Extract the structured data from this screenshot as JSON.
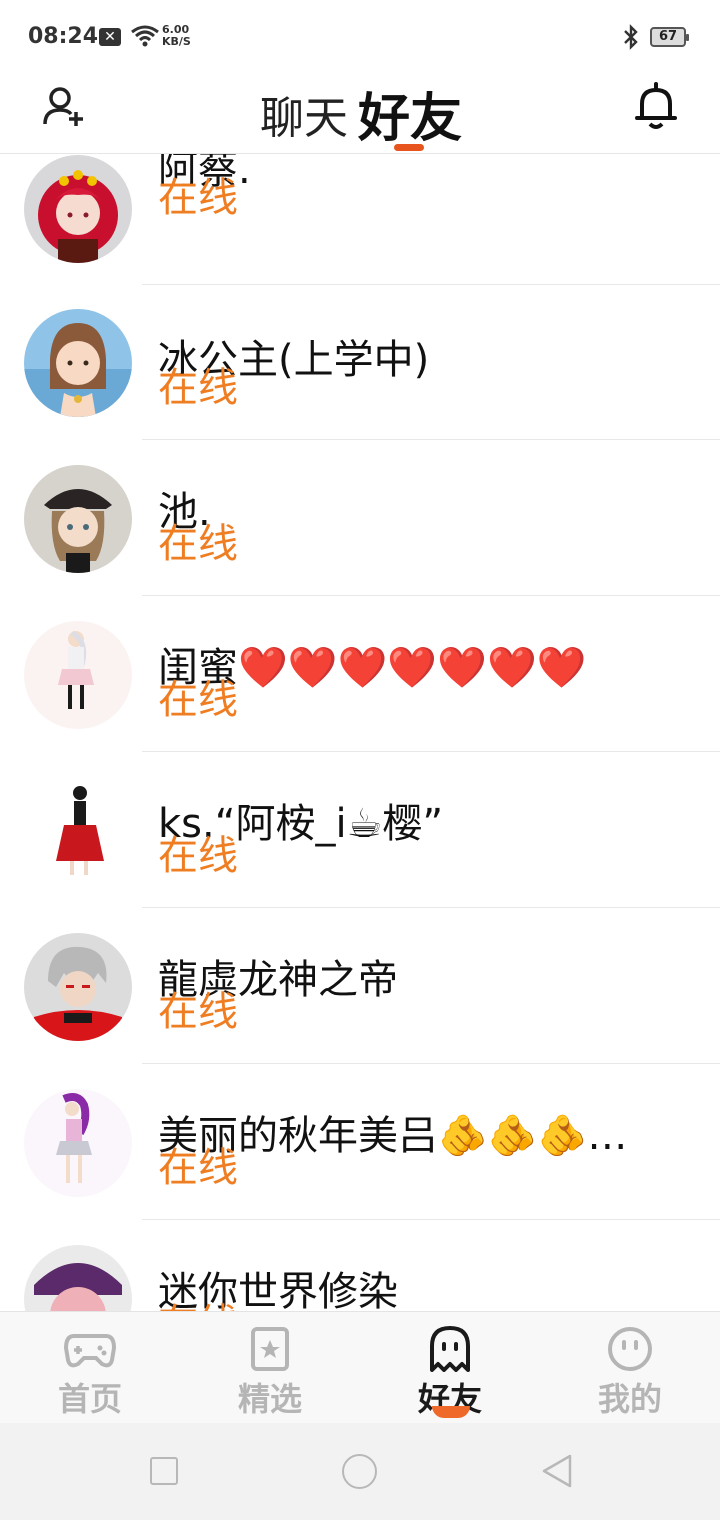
{
  "status_bar": {
    "time": "08:24",
    "notification_badge": "✕",
    "net_speed_value": "6.00",
    "net_speed_unit": "KB/S",
    "battery": "67"
  },
  "header": {
    "tab_chat": "聊天",
    "tab_friends": "好友",
    "active_tab": "好友",
    "accent_color": "#e8541e"
  },
  "friends": [
    {
      "name": "阿蔡.",
      "status": "在线"
    },
    {
      "name": "冰公主(上学中)",
      "status": "在线"
    },
    {
      "name": "池.",
      "status": "在线"
    },
    {
      "name": "闺蜜❤️❤️❤️❤️❤️❤️❤️",
      "status": "在线"
    },
    {
      "name": "ks.“阿桉_i☕樱”",
      "status": "在线"
    },
    {
      "name": "龍虡龙神之帝",
      "status": "在线"
    },
    {
      "name": "美丽的秋年美吕🫵🫵🫵…",
      "status": "在线"
    },
    {
      "name": "迷你世界修染",
      "status": "在线"
    }
  ],
  "status_color": "#ef7d22",
  "bottom_nav": {
    "items": [
      {
        "label": "首页",
        "icon": "gamepad-icon"
      },
      {
        "label": "精选",
        "icon": "star-card-icon"
      },
      {
        "label": "好友",
        "icon": "ghost-icon"
      },
      {
        "label": "我的",
        "icon": "smiley-icon"
      }
    ],
    "active": "好友"
  }
}
